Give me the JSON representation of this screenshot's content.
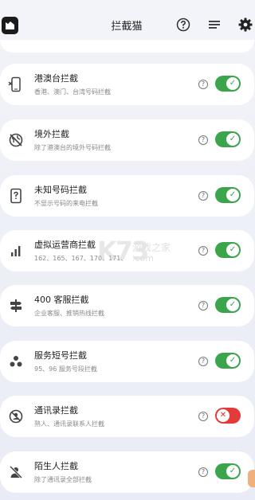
{
  "header": {
    "title": "拦截猫",
    "icons": [
      "app-logo-icon",
      "help-icon",
      "list-icon",
      "gear-icon"
    ]
  },
  "items": [
    {
      "title": "港澳台拦截",
      "subtitle": "香港、澳门、台湾号码拦截",
      "enabled": true,
      "icon": "phone-cancel-icon"
    },
    {
      "title": "境外拦截",
      "subtitle": "除了港澳台的境外号码拦截",
      "enabled": true,
      "icon": "globe-off-icon"
    },
    {
      "title": "未知号码拦截",
      "subtitle": "不显示号码的来电拦截",
      "enabled": true,
      "icon": "unknown-number-icon"
    },
    {
      "title": "虚拟运营商拦截",
      "subtitle": "162、165、167、170、171、",
      "enabled": true,
      "icon": "signal-bars-icon"
    },
    {
      "title": "400 客服拦截",
      "subtitle": "企业客服、推销热线拦截",
      "enabled": true,
      "icon": "signpost-icon"
    },
    {
      "title": "服务短号拦截",
      "subtitle": "95、96 服务号段拦截",
      "enabled": true,
      "icon": "three-dots-icon"
    },
    {
      "title": "通讯录拦截",
      "subtitle": "熟人、通讯录联系人拦截",
      "enabled": false,
      "icon": "contacts-block-icon"
    },
    {
      "title": "陌生人拦截",
      "subtitle": "除了通讯录全部拦截",
      "enabled": true,
      "icon": "person-off-icon"
    }
  ],
  "help_mark": "?",
  "toggle_on_glyph": "✓",
  "toggle_off_glyph": "✕",
  "watermark": {
    "logo": "K73",
    "name": "游戏之家",
    "domain": ".com"
  },
  "colors": {
    "toggle_on": "#3aa54a",
    "toggle_off": "#e43a3a",
    "background": "#f2f3f8"
  }
}
